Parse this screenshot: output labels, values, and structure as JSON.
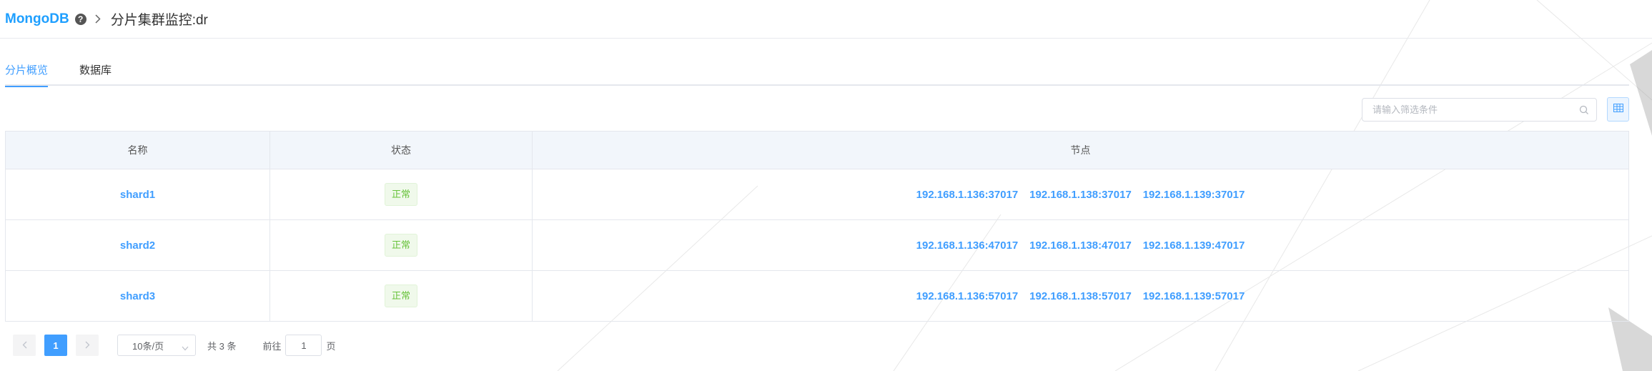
{
  "breadcrumb": {
    "brand": "MongoDB",
    "help_glyph": "?",
    "current": "分片集群监控:dr"
  },
  "tabs": [
    {
      "label": "分片概览",
      "active": true
    },
    {
      "label": "数据库",
      "active": false
    }
  ],
  "search": {
    "placeholder": "请输入筛选条件",
    "value": ""
  },
  "table": {
    "headers": {
      "name": "名称",
      "status": "状态",
      "nodes": "节点"
    },
    "rows": [
      {
        "name": "shard1",
        "status": "正常",
        "nodes": [
          "192.168.1.136:37017",
          "192.168.1.138:37017",
          "192.168.1.139:37017"
        ]
      },
      {
        "name": "shard2",
        "status": "正常",
        "nodes": [
          "192.168.1.136:47017",
          "192.168.1.138:47017",
          "192.168.1.139:47017"
        ]
      },
      {
        "name": "shard3",
        "status": "正常",
        "nodes": [
          "192.168.1.136:57017",
          "192.168.1.138:57017",
          "192.168.1.139:57017"
        ]
      }
    ]
  },
  "pagination": {
    "current_page": "1",
    "page_size": "10条/页",
    "total": "共 3 条",
    "goto_label": "前往",
    "goto_value": "1",
    "page_suffix": "页"
  },
  "colors": {
    "brand": "#1e9fff",
    "accent": "#409eff",
    "status_ok": "#67c23a"
  }
}
